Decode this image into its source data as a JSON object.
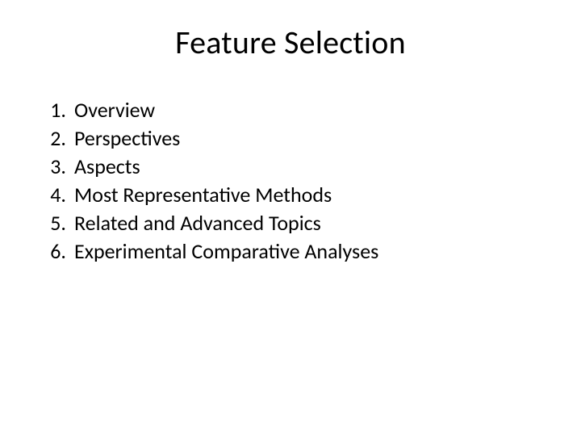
{
  "title": "Feature Selection",
  "items": [
    {
      "num": "1.",
      "label": "Overview"
    },
    {
      "num": "2.",
      "label": "Perspectives"
    },
    {
      "num": "3.",
      "label": "Aspects"
    },
    {
      "num": "4.",
      "label": "Most Representative Methods"
    },
    {
      "num": "5.",
      "label": "Related and Advanced Topics"
    },
    {
      "num": "6.",
      "label": "Experimental Comparative Analyses"
    }
  ]
}
